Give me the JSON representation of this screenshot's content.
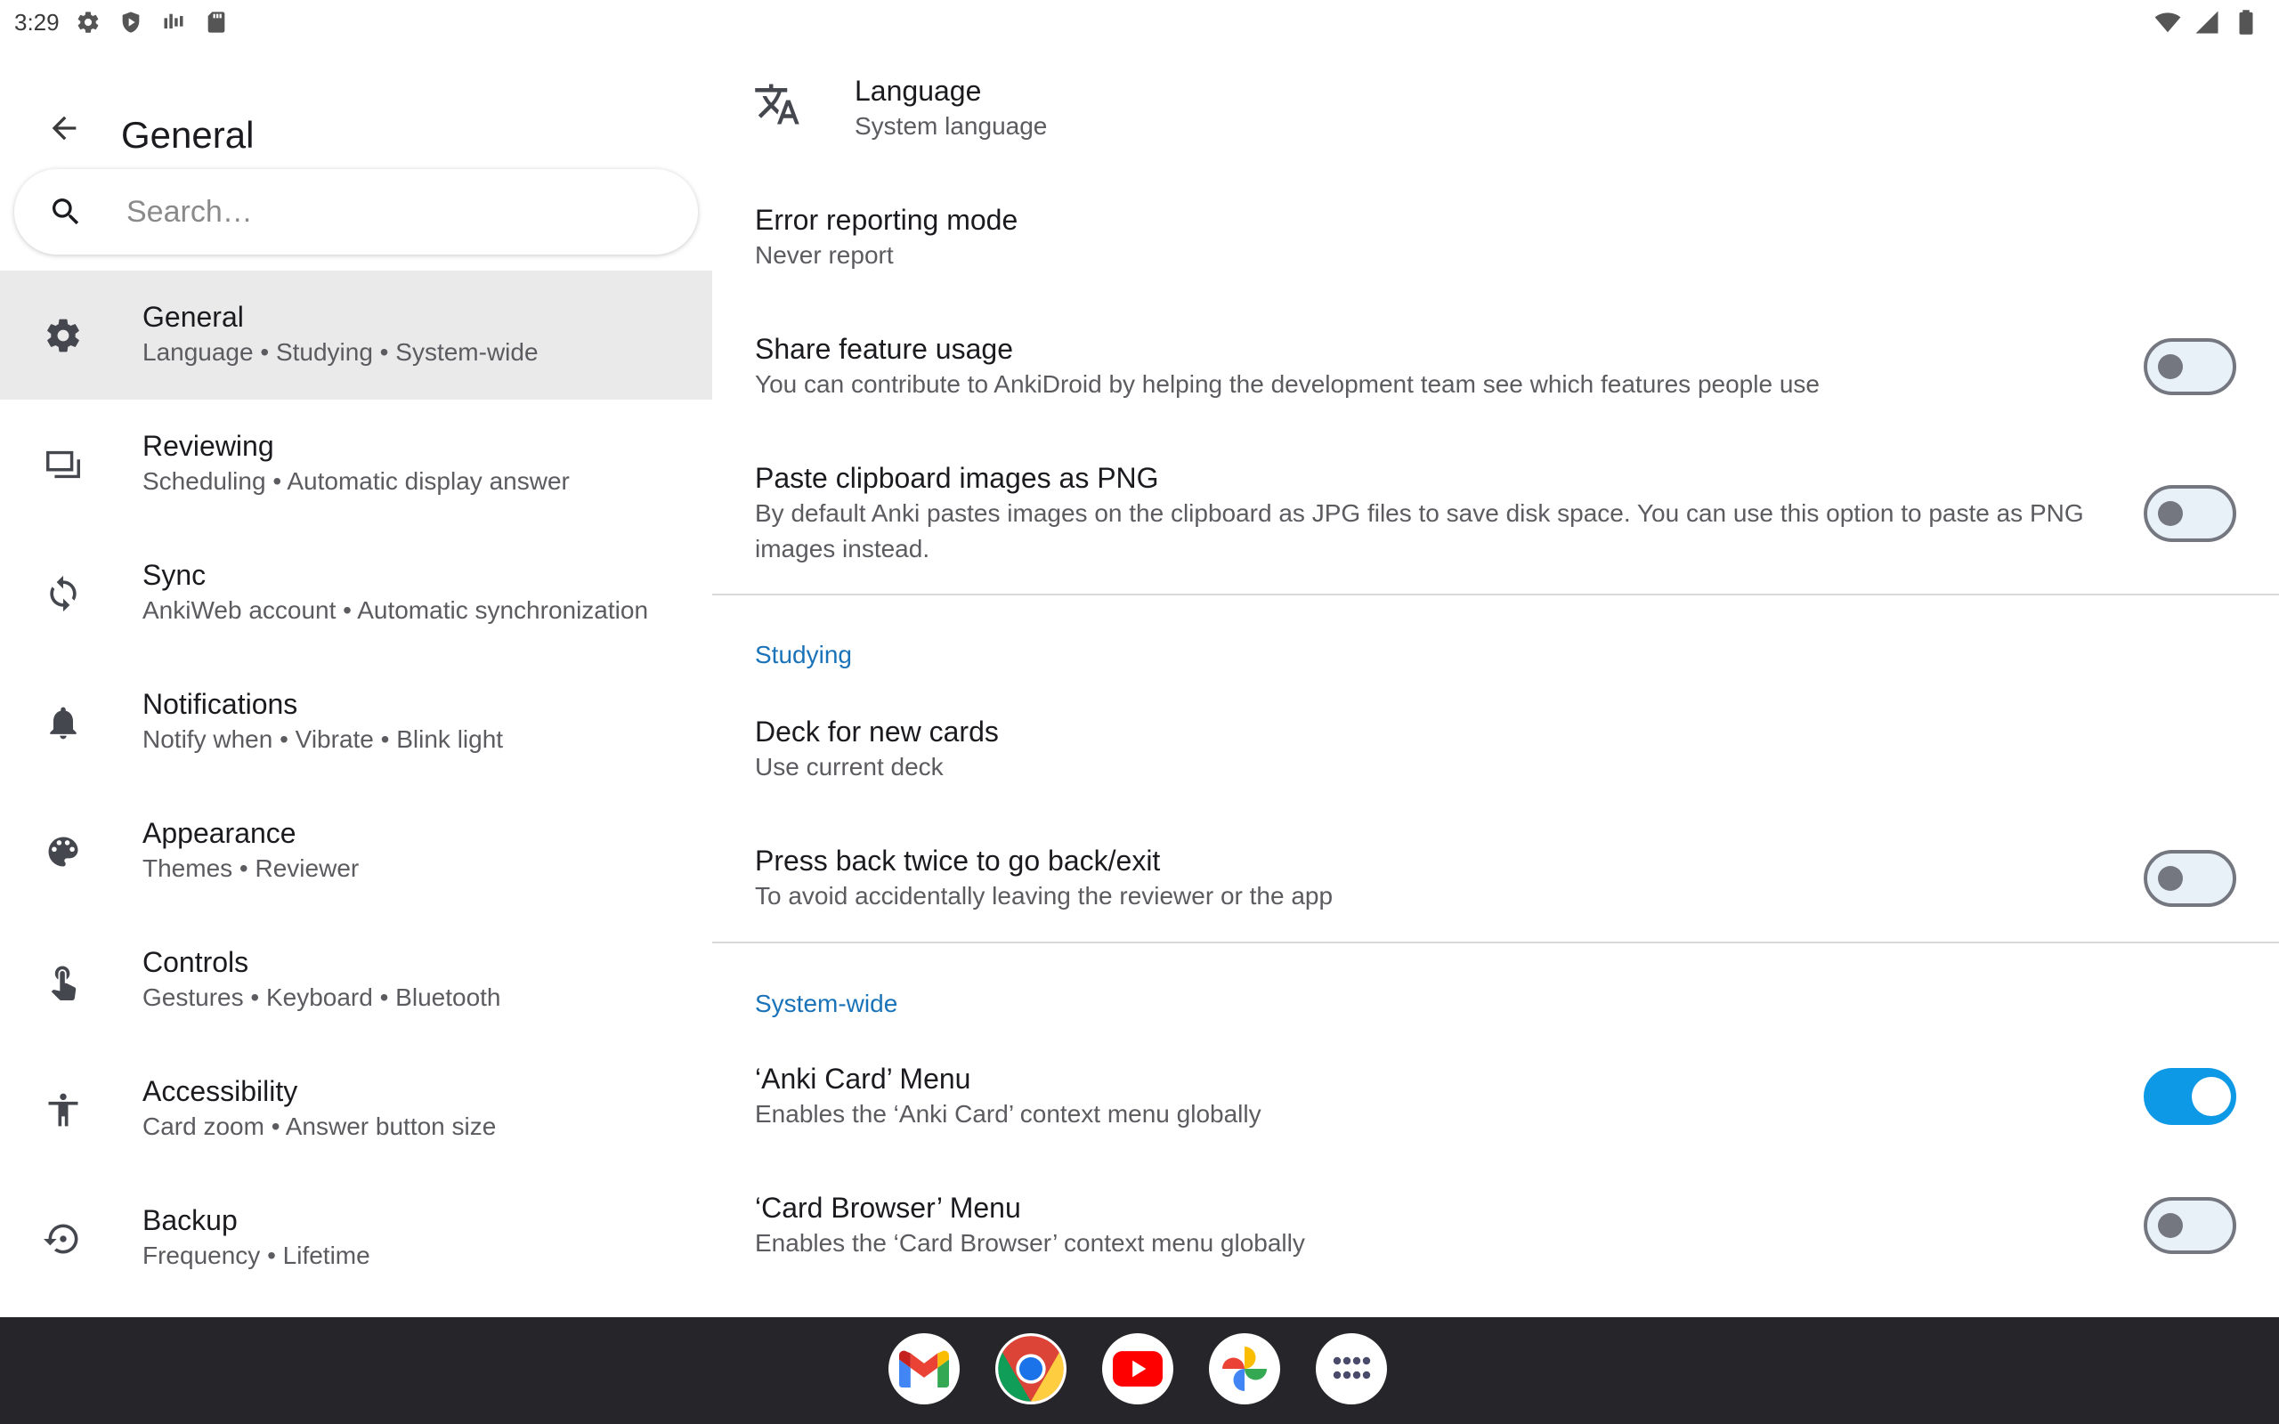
{
  "status_bar": {
    "time": "3:29",
    "left_icons": [
      "gear-icon",
      "shield-play-icon",
      "signal-bars-icon",
      "sd-card-icon"
    ],
    "right_icons": [
      "wifi-icon",
      "cell-signal-icon",
      "battery-icon"
    ]
  },
  "header": {
    "title": "General",
    "back_icon": "arrow-back-icon"
  },
  "search": {
    "placeholder": "Search…",
    "value": ""
  },
  "categories": [
    {
      "title": "General",
      "subtitle": "Language • Studying • System-wide",
      "icon": "gear-icon",
      "selected": true
    },
    {
      "title": "Reviewing",
      "subtitle": "Scheduling • Automatic display answer",
      "icon": "cards-icon",
      "selected": false
    },
    {
      "title": "Sync",
      "subtitle": "AnkiWeb account • Automatic synchronization",
      "icon": "sync-icon",
      "selected": false
    },
    {
      "title": "Notifications",
      "subtitle": "Notify when • Vibrate • Blink light",
      "icon": "bell-icon",
      "selected": false
    },
    {
      "title": "Appearance",
      "subtitle": "Themes • Reviewer",
      "icon": "palette-icon",
      "selected": false
    },
    {
      "title": "Controls",
      "subtitle": "Gestures • Keyboard • Bluetooth",
      "icon": "touch-icon",
      "selected": false
    },
    {
      "title": "Accessibility",
      "subtitle": "Card zoom • Answer button size",
      "icon": "accessibility-icon",
      "selected": false
    },
    {
      "title": "Backup",
      "subtitle": "Frequency • Lifetime",
      "icon": "backup-restore-icon",
      "selected": false
    }
  ],
  "prefs": {
    "language": {
      "title": "Language",
      "summary": "System language",
      "icon": "translate-icon"
    },
    "error_reporting": {
      "title": "Error reporting mode",
      "summary": "Never report"
    },
    "share_usage": {
      "title": "Share feature usage",
      "summary": "You can contribute to AnkiDroid by helping the development team see which features people use",
      "checked": false
    },
    "paste_png": {
      "title": "Paste clipboard images as PNG",
      "summary": "By default Anki pastes images on the clipboard as JPG files to save disk space. You can use this option to paste as PNG images instead.",
      "checked": false
    },
    "studying_header": "Studying",
    "deck_new_cards": {
      "title": "Deck for new cards",
      "summary": "Use current deck"
    },
    "press_back": {
      "title": "Press back twice to go back/exit",
      "summary": "To avoid accidentally leaving the reviewer or the app",
      "checked": false
    },
    "system_header": "System-wide",
    "anki_card_menu": {
      "title": "‘Anki Card’ Menu",
      "summary": "Enables the ‘Anki Card’ context menu globally",
      "checked": true
    },
    "card_browser_menu": {
      "title": "‘Card Browser’ Menu",
      "summary": "Enables the ‘Card Browser’ context menu globally",
      "checked": false
    }
  },
  "dock": {
    "apps": [
      "gmail-icon",
      "chrome-icon",
      "youtube-icon",
      "photos-icon",
      "app-drawer-icon"
    ]
  },
  "colors": {
    "accent": "#1a73b8",
    "toggle_on": "#0d99e6",
    "selected_bg": "#eaeaea",
    "dock_bg": "#26262a"
  }
}
